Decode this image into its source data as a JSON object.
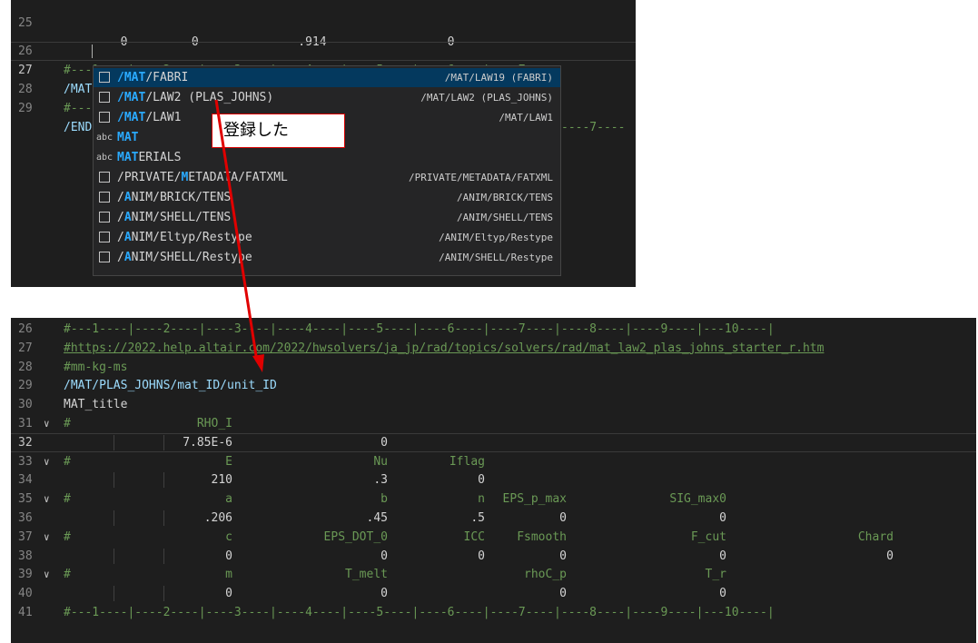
{
  "top_editor": {
    "lines": [
      {
        "n": "25",
        "text": "        0         0              .914                 0"
      },
      {
        "n": "26",
        "text": "#---1----|----2----|----3----|----4----|----5----|----6----|----7----"
      },
      {
        "n": "27",
        "text": "/MAT"
      },
      {
        "n": "28",
        "text": "#---"
      },
      {
        "n": "29",
        "text": "/END"
      }
    ],
    "line28_tail": "----7----"
  },
  "suggestions": [
    {
      "kind": "snippet",
      "pre": "",
      "hl": "/MAT",
      "post": "/FABRI",
      "detail": "/MAT/LAW19 (FABRI)",
      "selected": true
    },
    {
      "kind": "snippet",
      "pre": "",
      "hl": "/MAT",
      "post": "/LAW2 (PLAS_JOHNS)",
      "detail": "/MAT/LAW2 (PLAS_JOHNS)",
      "selected": false
    },
    {
      "kind": "snippet",
      "pre": "",
      "hl": "/MAT",
      "post": "/LAW1",
      "detail": "/MAT/LAW1",
      "selected": false
    },
    {
      "kind": "word",
      "pre": "",
      "hl": "MAT",
      "post": "",
      "detail": "",
      "selected": false
    },
    {
      "kind": "word",
      "pre": "",
      "hl": "MAT",
      "post": "ERIALS",
      "detail": "",
      "selected": false
    },
    {
      "kind": "snippet",
      "pre": "/PRIVATE/",
      "hl": "M",
      "post": "ETADATA/FATXML",
      "detail": "/PRIVATE/METADATA/FATXML",
      "selected": false
    },
    {
      "kind": "snippet",
      "pre": "/",
      "hl": "A",
      "post": "NIM/BRICK/TENS",
      "detail": "/ANIM/BRICK/TENS",
      "selected": false
    },
    {
      "kind": "snippet",
      "pre": "/",
      "hl": "A",
      "post": "NIM/SHELL/TENS",
      "detail": "/ANIM/SHELL/TENS",
      "selected": false
    },
    {
      "kind": "snippet",
      "pre": "/",
      "hl": "A",
      "post": "NIM/Eltyp/Restype",
      "detail": "/ANIM/Eltyp/Restype",
      "selected": false
    },
    {
      "kind": "snippet",
      "pre": "/",
      "hl": "A",
      "post": "NIM/SHELL/Restype",
      "detail": "/ANIM/SHELL/Restype",
      "selected": false
    }
  ],
  "annotation": {
    "text": "登録した",
    "color": "#d80000"
  },
  "bottom_editor": {
    "ruler": "#---1----|----2----|----3----|----4----|----5----|----6----|----7----|----8----|----9----|---10----|",
    "url": "#https://2022.help.altair.com/2022/hwsolvers/ja_jp/rad/topics/solvers/rad/mat_law2_plas_johns_starter_r.htm",
    "units": "#mm-kg-ms",
    "mat_keyword": "/MAT/PLAS_JOHNS/mat_ID/unit_ID",
    "title": "MAT_title",
    "line_numbers": [
      "26",
      "27",
      "28",
      "29",
      "30",
      "31",
      "32",
      "33",
      "34",
      "35",
      "36",
      "37",
      "38",
      "39",
      "40",
      "41"
    ],
    "header_rows": [
      {
        "n": "31",
        "cells": [
          "RHO_I"
        ]
      },
      {
        "n": "33",
        "cells": [
          "E",
          "Nu",
          "Iflag"
        ]
      },
      {
        "n": "35",
        "cells": [
          "a",
          "b",
          "n",
          "EPS_p_max",
          "SIG_max0"
        ]
      },
      {
        "n": "37",
        "cells": [
          "c",
          "EPS_DOT_0",
          "ICC",
          "Fsmooth",
          "F_cut",
          "Chard"
        ]
      },
      {
        "n": "39",
        "cells": [
          "m",
          "T_melt",
          "rhoC_p",
          "T_r"
        ]
      }
    ],
    "value_rows": [
      {
        "n": "32",
        "cells": [
          "7.85E-6",
          "0"
        ]
      },
      {
        "n": "34",
        "cells": [
          "210",
          ".3",
          "0"
        ]
      },
      {
        "n": "36",
        "cells": [
          ".206",
          ".45",
          ".5",
          "0",
          "0"
        ]
      },
      {
        "n": "38",
        "cells": [
          "0",
          "0",
          "0",
          "0",
          "0",
          "0"
        ]
      },
      {
        "n": "40",
        "cells": [
          "0",
          "0",
          "0",
          "0"
        ]
      }
    ]
  }
}
